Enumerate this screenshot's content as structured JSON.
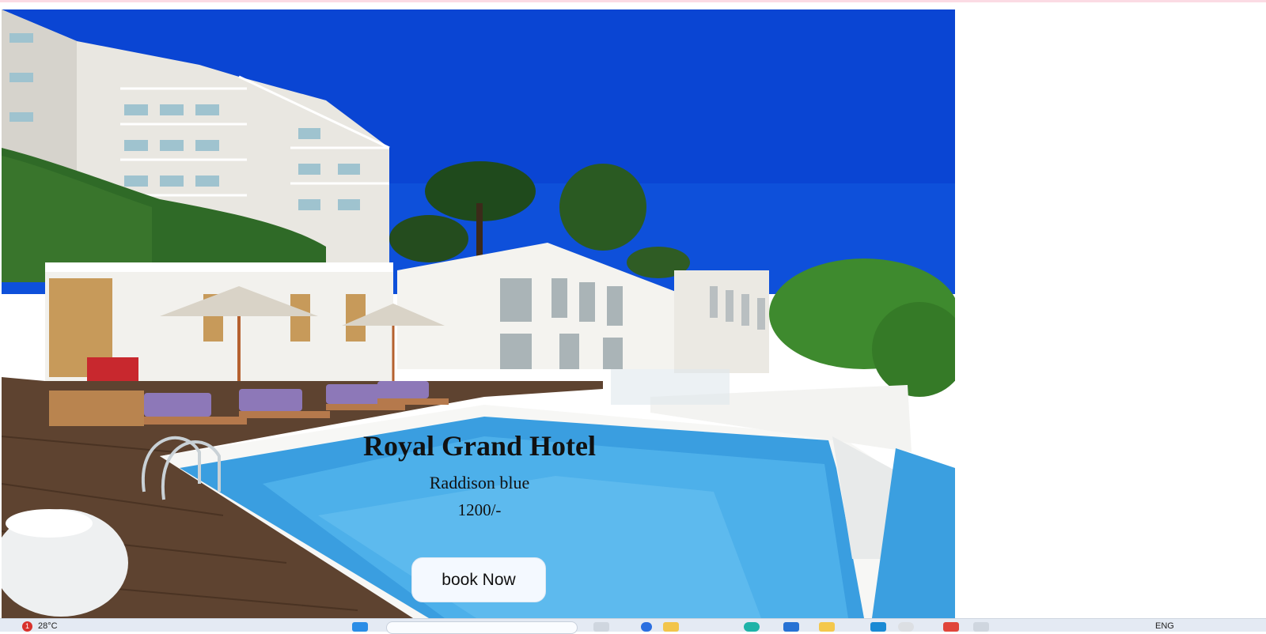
{
  "hero": {
    "title": "Royal Grand Hotel",
    "subtitle": "Raddison blue",
    "price": "1200/-",
    "book_label": "book Now"
  },
  "taskbar": {
    "weather_badge": "1",
    "weather_temp": "28°C",
    "language": "ENG"
  },
  "colors": {
    "sky": "#0b4fdc",
    "pool": "#3a9ee0",
    "deck": "#6a4a36",
    "button_bg": "#f4f9ff"
  }
}
